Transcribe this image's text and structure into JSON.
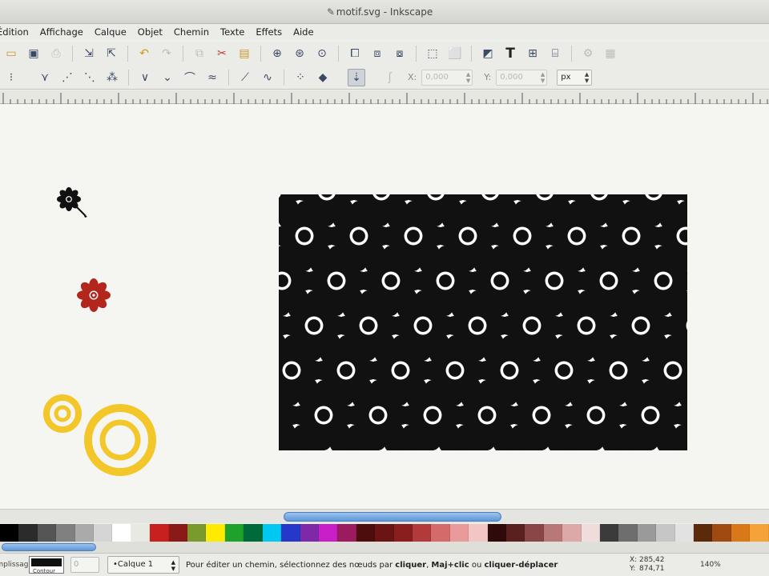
{
  "window": {
    "title": "motif.svg - Inkscape"
  },
  "menu": [
    "Édition",
    "Affichage",
    "Calque",
    "Objet",
    "Chemin",
    "Texte",
    "Effets",
    "Aide"
  ],
  "command_bar": {
    "icons": [
      "new-icon",
      "open-icon",
      "save-icon",
      "print-icon",
      "import-icon",
      "export-icon",
      "undo-icon",
      "redo-icon",
      "copy-icon",
      "cut-icon",
      "paste-icon",
      "zoom-selection-icon",
      "zoom-drawing-icon",
      "zoom-page-icon",
      "duplicate-icon",
      "clone-icon",
      "unlink-clone-icon",
      "group-icon",
      "ungroup-icon",
      "fill-stroke-icon",
      "text-tool-icon",
      "align-icon",
      "xml-editor-icon",
      "preferences-icon",
      "document-properties-icon"
    ]
  },
  "controls_bar": {
    "x_value": "0,000",
    "y_value": "0,000",
    "unit": "px"
  },
  "palette": {
    "colors": [
      "#000000",
      "#2b2b2b",
      "#555555",
      "#808080",
      "#aaaaaa",
      "#d5d5d5",
      "#ffffff",
      "#e9e9e4",
      "#c8201e",
      "#8a1a18",
      "#7b9a2c",
      "#ffeb00",
      "#1fa22b",
      "#006b3a",
      "#00c8f0",
      "#2538c9",
      "#7e2aa8",
      "#c81fc8",
      "#9b1b5e",
      "#4d0d0d",
      "#6a1414",
      "#8a1e1e",
      "#b23a3a",
      "#d46a6a",
      "#e99a9a",
      "#f3c6c6",
      "#2e0a0a",
      "#5a2020",
      "#8a4646",
      "#b87878",
      "#dca8a8",
      "#f1dcdc",
      "#3b3b3b",
      "#6e6e6e",
      "#9a9a9a",
      "#c6c6c6",
      "#e2e2e2",
      "#5a2a0a",
      "#a04a12",
      "#d97818",
      "#f5a238"
    ]
  },
  "status": {
    "fill_label": "Remplissage",
    "stroke_label": "Contour",
    "stroke_width": "0",
    "layer": "•Calque 1",
    "message_start": "Pour éditer un chemin, sélectionnez des nœuds par ",
    "message_b1": "cliquer",
    "message_mid1": ", ",
    "message_b2": "Maj+clic",
    "message_mid2": " ou ",
    "message_b3": "cliquer-déplacer",
    "x_label": "X:",
    "x_value": "285,42",
    "y_label": "Y:",
    "y_value": "874,71",
    "zoom": "140%"
  },
  "canvas": {
    "pattern_fill": "#111111",
    "flower_red": "#b3261e",
    "ring_yellow": "#f3c62a"
  }
}
